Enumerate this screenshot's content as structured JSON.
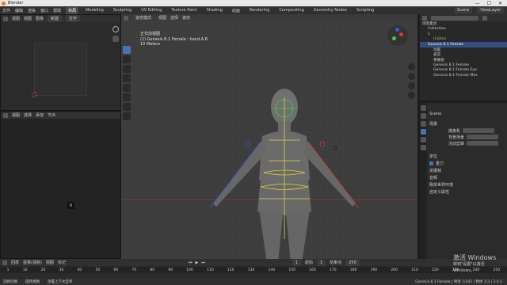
{
  "titlebar": {
    "title": "Blender",
    "min": "—",
    "max": "☐",
    "close": "✕"
  },
  "menubar": {
    "menus": [
      "文件",
      "编辑",
      "渲染",
      "窗口",
      "帮助"
    ],
    "tabs": [
      {
        "label": "布局",
        "active": true
      },
      {
        "label": "Modeling",
        "active": false
      },
      {
        "label": "Sculpting",
        "active": false
      },
      {
        "label": "UV Editing",
        "active": false
      },
      {
        "label": "Texture Paint",
        "active": false
      },
      {
        "label": "Shading",
        "active": false
      },
      {
        "label": "动画",
        "active": false
      },
      {
        "label": "Rendering",
        "active": false
      },
      {
        "label": "Compositing",
        "active": false
      },
      {
        "label": "Geometry Nodes",
        "active": false
      },
      {
        "label": "Scripting",
        "active": false
      }
    ],
    "scene": "Scene",
    "view_layer": "ViewLayer"
  },
  "left_top": {
    "header": [
      "视图",
      "视图",
      "图像",
      "新建",
      "打开"
    ]
  },
  "left_bottom": {
    "header": [
      "视图",
      "选择",
      "添加",
      "节点"
    ],
    "playhead_label": "n"
  },
  "viewport": {
    "header": [
      "姿态模式",
      "视图",
      "选择",
      "姿态"
    ],
    "mode_badge": "姿态模式",
    "info_lines": [
      "正交前视图",
      "(1) Genesis 8.1 Female : hand.A.R",
      "10 Meters"
    ],
    "accent": "#4772b3"
  },
  "outliner": {
    "search_placeholder": "",
    "rows": [
      {
        "label": "场景集合",
        "indent": 0,
        "selected": false
      },
      {
        "label": "Collection",
        "indent": 1,
        "selected": false
      },
      {
        "label": "1",
        "indent": 1,
        "selected": false
      },
      {
        "label": "Hidden",
        "indent": 2,
        "selected": false
      },
      {
        "label": "Genesis 8.1 Female",
        "indent": 1,
        "selected": true
      },
      {
        "label": "动画",
        "indent": 2,
        "selected": false
      },
      {
        "label": "姿态",
        "indent": 2,
        "selected": false
      },
      {
        "label": "骨骼组",
        "indent": 2,
        "selected": false
      },
      {
        "label": "Genesis 8.1 Female",
        "indent": 2,
        "selected": false
      },
      {
        "label": "Genesis 8.1 Female Eye",
        "indent": 2,
        "selected": false
      },
      {
        "label": "Genesis 8.1 Female Mes",
        "indent": 2,
        "selected": false
      }
    ]
  },
  "props": {
    "scene_name": "Scene",
    "section_scene": "场景",
    "rows": [
      {
        "label": "摄像机"
      },
      {
        "label": "背景场景"
      },
      {
        "label": "活动剪辑"
      }
    ],
    "sections": [
      "单位",
      "重力",
      "关键帧",
      "音频",
      "刚体世界环境",
      "自定义属性"
    ]
  },
  "timeline": {
    "header": [
      "回放",
      "抠像(插帧)",
      "视图",
      "标记"
    ],
    "current_frame": "1",
    "start_label": "起始",
    "start": "1",
    "end_label": "结束点",
    "end": "250",
    "ruler": [
      "1",
      "10",
      "20",
      "30",
      "40",
      "50",
      "60",
      "70",
      "80",
      "90",
      "100",
      "110",
      "120",
      "130",
      "140",
      "150",
      "160",
      "170",
      "180",
      "190",
      "200",
      "210",
      "220",
      "230",
      "240",
      "250"
    ]
  },
  "statusbar": {
    "left": "选择切换",
    "middle": "旋转视图",
    "right_hint": "放置上下文菜单",
    "stats": "Genesis 8.1 Female | 骨架 1/342 | 物体 1/3 | 3.0.1"
  },
  "watermark": {
    "line1": "激活 Windows",
    "line2": "转到\"设置\"以激活 Windows。"
  }
}
